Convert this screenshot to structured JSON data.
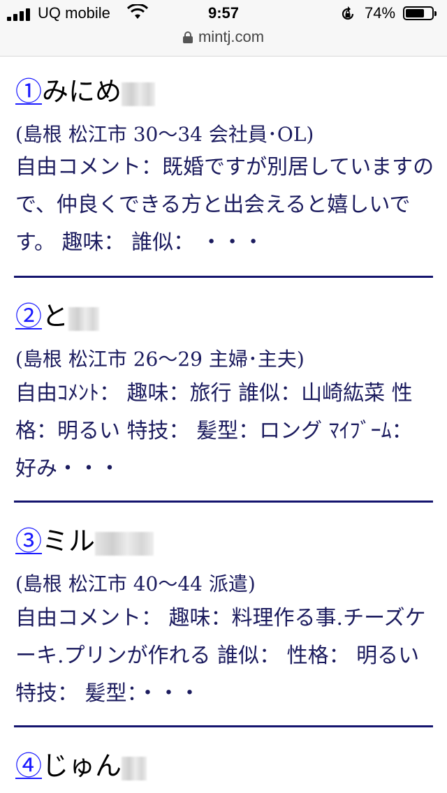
{
  "status": {
    "carrier": "UQ mobile",
    "time": "9:57",
    "battery": "74%",
    "battery_level": 0.74
  },
  "browser": {
    "url": "mintj.com"
  },
  "entries": [
    {
      "num": "①",
      "name": "みにめ",
      "meta": "(島根 松江市 30〜34 会社員･OL)",
      "comment": "自由コメント：既婚ですが別居していますので、仲良くできる方と出会えると嬉しいです。 趣味： 誰似： ・・・"
    },
    {
      "num": "②",
      "name": "と",
      "meta": "(島根 松江市 26〜29 主婦･主夫)",
      "comment": "自由ｺﾒﾝﾄ： 趣味：旅行 誰似：山崎紘菜 性格：明るい 特技： 髪型：ロング ﾏｲﾌﾞｰﾑ： 好み・・・"
    },
    {
      "num": "③",
      "name": "ミル",
      "meta": "(島根 松江市 40〜44 派遣)",
      "comment": "自由コメント： 趣味：料理作る事.チーズケーキ.プリンが作れる 誰似： 性格： 明るい 特技： 髪型：・・・"
    },
    {
      "num": "④",
      "name": "じゅん"
    }
  ]
}
